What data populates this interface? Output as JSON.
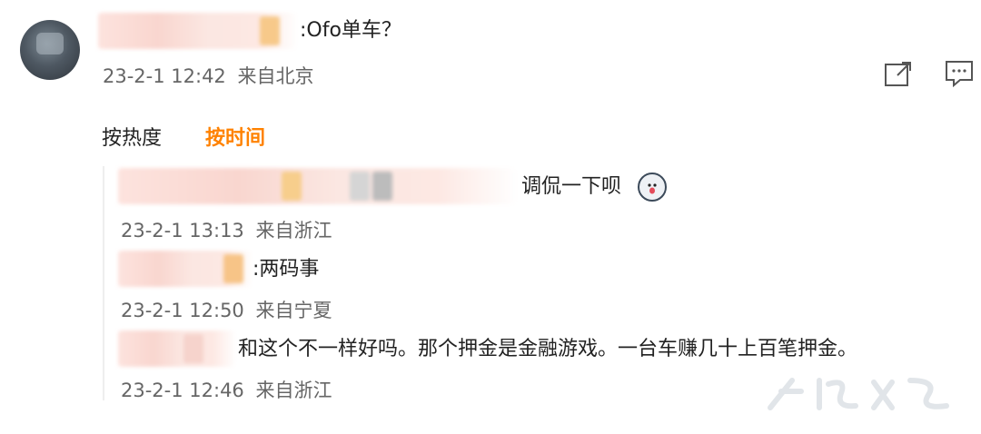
{
  "post": {
    "comment_text": ":Ofo单车？",
    "time": "23-2-1 12:42",
    "location": "来自北京"
  },
  "icons": {
    "share": "share-external-icon",
    "comment": "comment-bubble-icon"
  },
  "sort": {
    "hot_label": "按热度",
    "time_label": "按时间",
    "active_color": "#ff8200"
  },
  "replies": [
    {
      "text": "调侃一下呗",
      "time": "23-2-1 13:13",
      "location": "来自浙江",
      "emoji": "dog-tongue-emoji"
    },
    {
      "text": ":两码事",
      "time": "23-2-1 12:50",
      "location": "来自宁夏"
    },
    {
      "text": "和这个不一样好吗。那个押金是金融游戏。一台车赚几十上百笔押金。",
      "time": "23-2-1 12:46",
      "location": "来自浙江"
    }
  ]
}
